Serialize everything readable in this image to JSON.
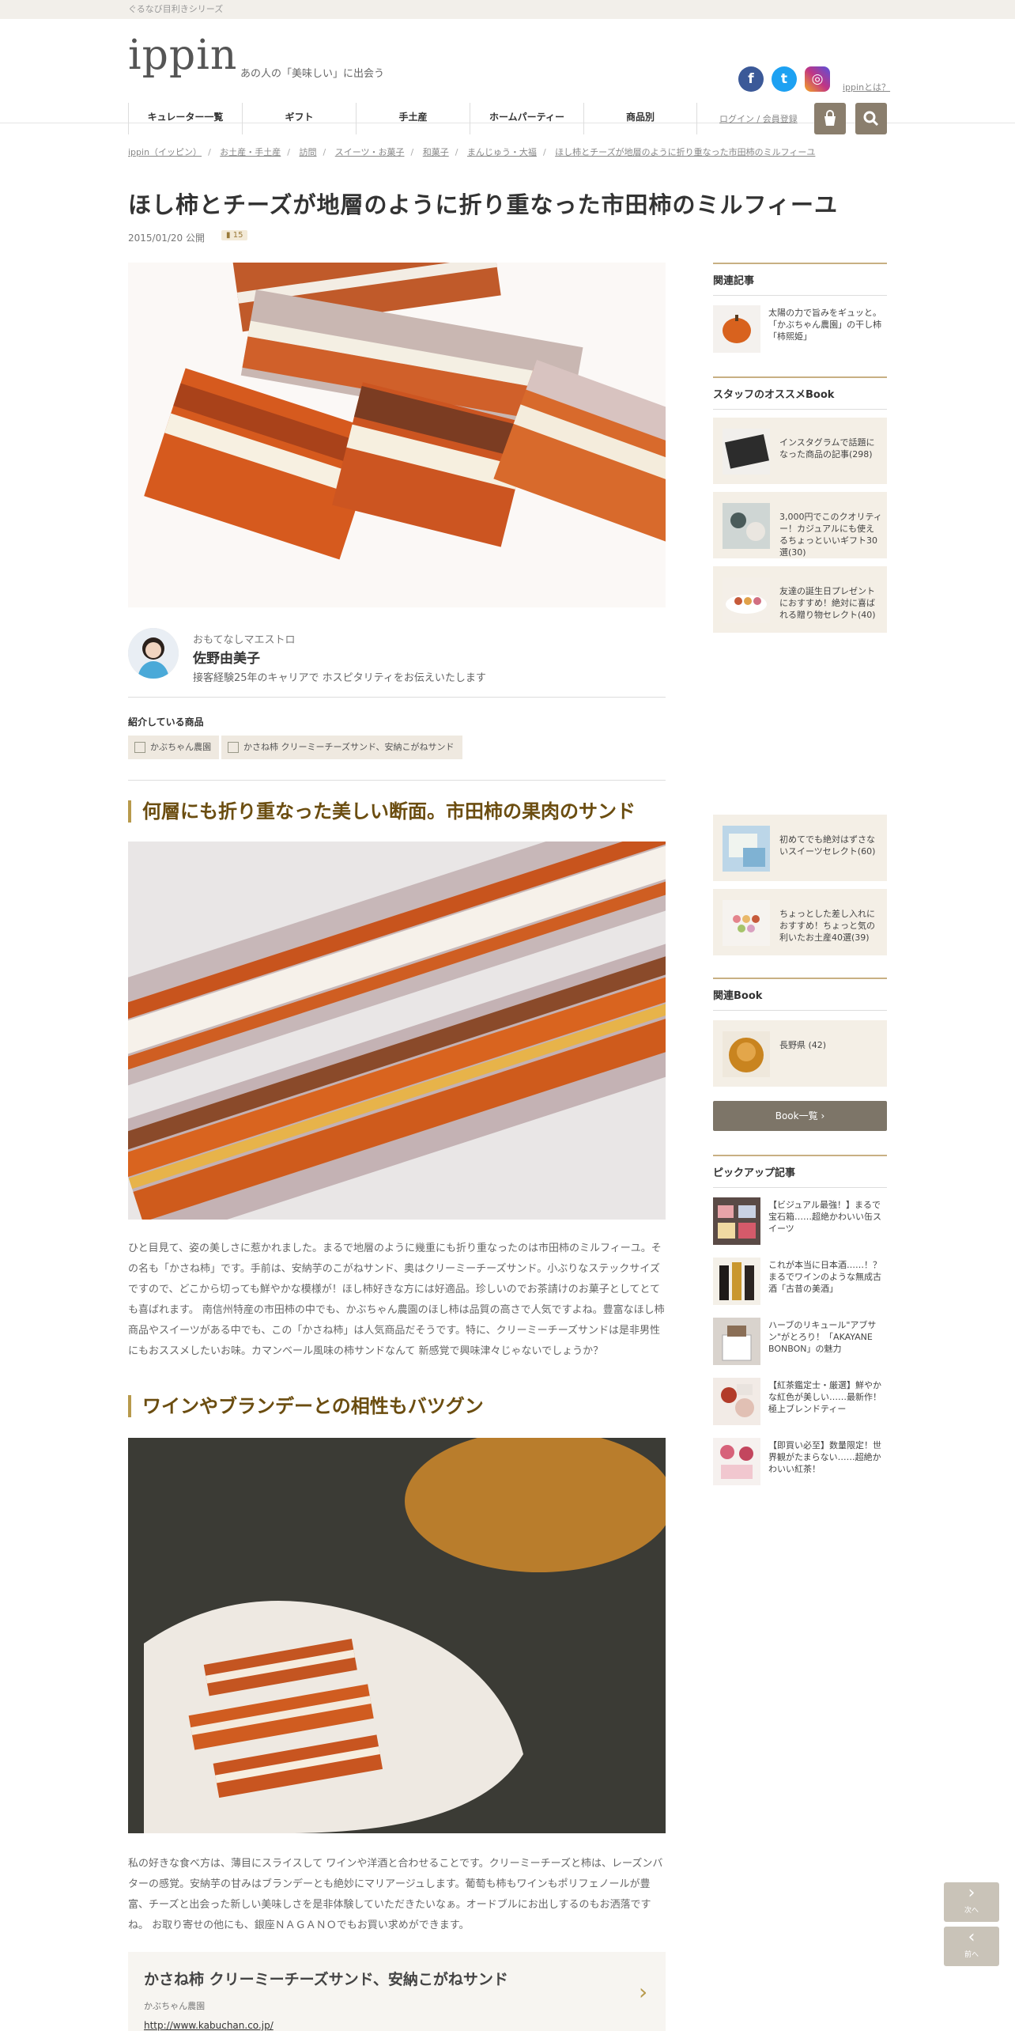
{
  "topbar": {
    "text": "ぐるなび目利きシリーズ"
  },
  "header": {
    "logo": "ippin",
    "tagline": "あの人の「美味しい」に出会う",
    "about_link": "ippinとは？",
    "login_link": "ログイン / 会員登録",
    "nav": [
      "キュレーター一覧",
      "ギフト",
      "手土産",
      "ホームパーティー",
      "商品別"
    ],
    "social_icons": [
      {
        "name": "facebook",
        "label": "f",
        "color": "#3b5998"
      },
      {
        "name": "twitter",
        "label": "t",
        "color": "#1da1f2"
      },
      {
        "name": "instagram",
        "label": "◎",
        "color": "#c13584"
      }
    ]
  },
  "breadcrumb": [
    "ippin（イッピン）",
    "お土産・手土産",
    "訪問",
    "スイーツ・お菓子",
    "和菓子",
    "まんじゅう・大福",
    "ほし柿とチーズが地層のように折り重なった市田柿のミルフィーユ"
  ],
  "article": {
    "title": "ほし柿とチーズが地層のように折り重なった市田柿のミルフィーユ",
    "date": "2015/01/20 公開",
    "bookmark_count": "15",
    "author": {
      "role": "おもてなしマエストロ",
      "name": "佐野由美子",
      "desc": "接客経験25年のキャリアで ホスピタリティをお伝えいたします"
    },
    "products_heading": "紹介している商品",
    "product_tags": [
      "かぶちゃん農園",
      "かさね柿 クリーミーチーズサンド、安納こがねサンド"
    ],
    "section1": {
      "heading": "何層にも折り重なった美しい断面。市田柿の果肉のサンド",
      "text": "ひと目見て、姿の美しさに惹かれました。まるで地層のように幾重にも折り重なったのは市田柿のミルフィーユ。その名も「かさね柿」です。手前は、安納芋のこがねサンド、奥はクリーミーチーズサンド。小ぶりなステックサイズですので、どこから切っても鮮やかな模様が！ほし柿好きな方には好適品。珍しいのでお茶請けのお菓子としてとても喜ばれます。 南信州特産の市田柿の中でも、かぶちゃん農園のほし柿は品質の高さで人気ですよね。豊富なほし柿商品やスイーツがある中でも、この「かさね柿」は人気商品だそうです。特に、クリーミーチーズサンドは是非男性にもおススメしたいお味。カマンベール風味の柿サンドなんて 新感覚で興味津々じゃないでしょうか？"
    },
    "section2": {
      "heading": "ワインやブランデーとの相性もバツグン",
      "text": "私の好きな食べ方は、薄目にスライスして ワインや洋酒と合わせることです。クリーミーチーズと柿は、レーズンバターの感覚。安納芋の甘みはブランデーとも絶妙にマリアージュします。葡萄も柿もワインもポリフェノールが豊富、チーズと出会った新しい美味しさを是非体験していただきたいなぁ。オードブルにお出しするのもお洒落ですね。 お取り寄せの他にも、銀座ＮＡＧＡＮＯでもお買い求めができます。"
    },
    "product_box": {
      "title": "かさね柿 クリーミーチーズサンド、安納こがねサンド",
      "vendor": "かぶちゃん農園",
      "url": "http://www.kabuchan.co.jp/"
    }
  },
  "sidebar": {
    "related_heading": "関連記事",
    "related": [
      {
        "text": "太陽の力で旨みをギュッと。「かぶちゃん農園」の干し柿「柿煕姫」"
      }
    ],
    "staff_heading": "スタッフのオススメBook",
    "staff_books": [
      {
        "text": "インスタグラムで話題になった商品の記事(298)"
      },
      {
        "text": "3,000円でこのクオリティー！カジュアルにも使えるちょっといいギフト30選(30)"
      },
      {
        "text": "友達の誕生日プレゼントにおすすめ！絶対に喜ばれる贈り物セレクト(40)"
      },
      {
        "text": "初めてでも絶対はずさないスイーツセレクト(60)"
      },
      {
        "text": "ちょっとした差し入れにおすすめ！ちょっと気の利いたお土産40選(39)"
      }
    ],
    "book_heading": "関連Book",
    "books": [
      {
        "text": "長野県 (42)"
      }
    ],
    "book_list_button": "Book一覧",
    "pickup_heading": "ピックアップ記事",
    "pickup": [
      {
        "text": "【ビジュアル最強！】まるで宝石箱……超絶かわいい缶スイーツ"
      },
      {
        "text": "これが本当に日本酒……！？まるでワインのような無成古酒「古昔の美酒」"
      },
      {
        "text": "ハーブのリキュール\"アブサン\"がとろり！「AKAYANE BONBON」の魅力"
      },
      {
        "text": "【紅茶鑑定士・厳選】鮮やかな紅色が美しい……最新作！極上ブレンドティー"
      },
      {
        "text": "【即買い必至】数量限定！世界観がたまらない……超絶かわいい紅茶！"
      }
    ]
  },
  "pager": {
    "next": "次へ",
    "prev": "前へ"
  }
}
